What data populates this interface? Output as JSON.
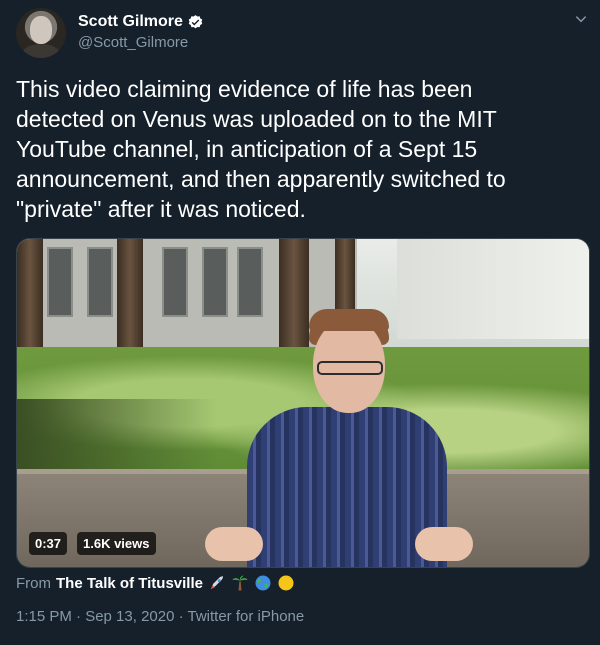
{
  "author": {
    "name": "Scott Gilmore",
    "handle": "@Scott_Gilmore"
  },
  "tweet": {
    "lines": [
      "This video claiming evidence of life has been",
      "detected on Venus was uploaded on to the MIT",
      "YouTube channel, in anticipation of a Sept 15",
      "announcement, and then apparently switched to",
      "\"private\" after it was noticed."
    ]
  },
  "video": {
    "duration": "0:37",
    "views": "1.6K views"
  },
  "source": {
    "prefix": "From",
    "channel": "The Talk of Titusville",
    "emojis": [
      "rocket-icon",
      "palm-tree-icon",
      "globe-icon",
      "sun-icon"
    ]
  },
  "meta": {
    "time": "1:15 PM · Sep 13, 2020 · Twitter for iPhone"
  },
  "colors": {
    "background": "#15202b",
    "text": "#ffffff",
    "secondary": "#8899a6",
    "verified": "#ffffff"
  }
}
